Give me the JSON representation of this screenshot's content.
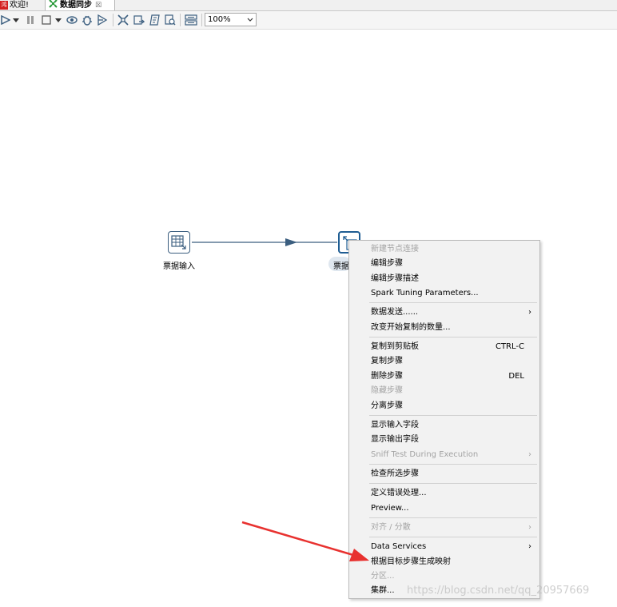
{
  "tabs": [
    {
      "label": "欢迎!",
      "icon": "welcome-icon",
      "active": false
    },
    {
      "label": "数据同步",
      "icon": "transformation-icon",
      "active": true,
      "close": "☒"
    }
  ],
  "toolbar": {
    "buttons": [
      "run-icon",
      "run-dropdown-icon",
      "pause-icon",
      "stop-icon",
      "stop-dropdown-icon",
      "preview-icon",
      "debug-icon",
      "replay-icon",
      "verify-icon",
      "impact-icon",
      "sql-icon",
      "explore-db-icon",
      "show-results-icon"
    ],
    "zoom": "100%"
  },
  "canvas": {
    "steps": [
      {
        "label": "票据输入",
        "icon": "table-input-icon"
      },
      {
        "label": "票据",
        "icon": "table-output-icon"
      }
    ],
    "hop_color": "#3b5e7f"
  },
  "context_menu": {
    "groups": [
      [
        {
          "label": "新建节点连接",
          "disabled": true
        },
        {
          "label": "编辑步骤"
        },
        {
          "label": "编辑步骤描述"
        },
        {
          "label": "Spark Tuning Parameters..."
        }
      ],
      [
        {
          "label": "数据发送......",
          "submenu": true
        },
        {
          "label": "改变开始复制的数量..."
        }
      ],
      [
        {
          "label": "复制到剪贴板",
          "shortcut": "CTRL-C"
        },
        {
          "label": "复制步骤"
        },
        {
          "label": "删除步骤",
          "shortcut": "DEL"
        },
        {
          "label": "隐藏步骤",
          "disabled": true
        },
        {
          "label": "分离步骤"
        }
      ],
      [
        {
          "label": "显示输入字段"
        },
        {
          "label": "显示输出字段"
        },
        {
          "label": "Sniff Test During Execution",
          "disabled": true,
          "submenu": true
        }
      ],
      [
        {
          "label": "检查所选步骤"
        }
      ],
      [
        {
          "label": "定义错误处理..."
        },
        {
          "label": "Preview..."
        }
      ],
      [
        {
          "label": "对齐 / 分散",
          "disabled": true,
          "submenu": true
        }
      ],
      [
        {
          "label": "Data Services",
          "submenu": true
        },
        {
          "label": "根据目标步骤生成映射"
        },
        {
          "label": "分区...",
          "disabled": true
        },
        {
          "label": "集群..."
        }
      ]
    ],
    "submenu_arrow": "›"
  },
  "annotation": {
    "arrow_color": "#e8312f"
  },
  "watermark": "https://blog.csdn.net/qq_20957669"
}
